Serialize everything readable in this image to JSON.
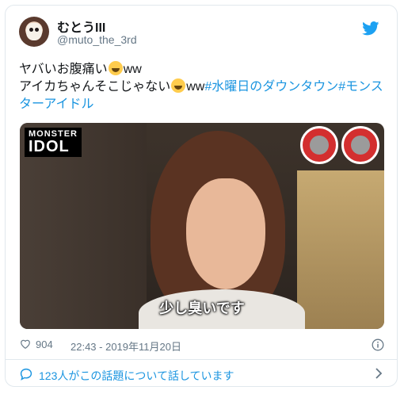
{
  "user": {
    "display_name": "むとうIII",
    "handle": "@muto_the_3rd"
  },
  "tweet": {
    "line1": "ヤバいお腹痛い",
    "line1_suffix": "ww",
    "line2": "アイカちゃんそこじゃない",
    "line2_suffix": "ww",
    "hashtags": [
      "#水曜日のダウンタウン",
      "#モンスターアイドル"
    ]
  },
  "media": {
    "logo_line1": "MONSTER",
    "logo_line2": "IDOL",
    "subtitle": "少し臭いです"
  },
  "meta": {
    "likes": "904",
    "timestamp": "22:43 - 2019年11月20日"
  },
  "footer": {
    "conversation": "123人がこの話題について話しています"
  },
  "icons": {
    "twitter_bird": "twitter-bird-icon",
    "heart": "heart-icon",
    "info": "info-icon",
    "comment": "speech-bubble-icon",
    "chevron": "chevron-right-icon"
  },
  "colors": {
    "accent": "#1b95e0",
    "text": "#14171a",
    "muted": "#657786",
    "border": "#e1e8ed"
  }
}
